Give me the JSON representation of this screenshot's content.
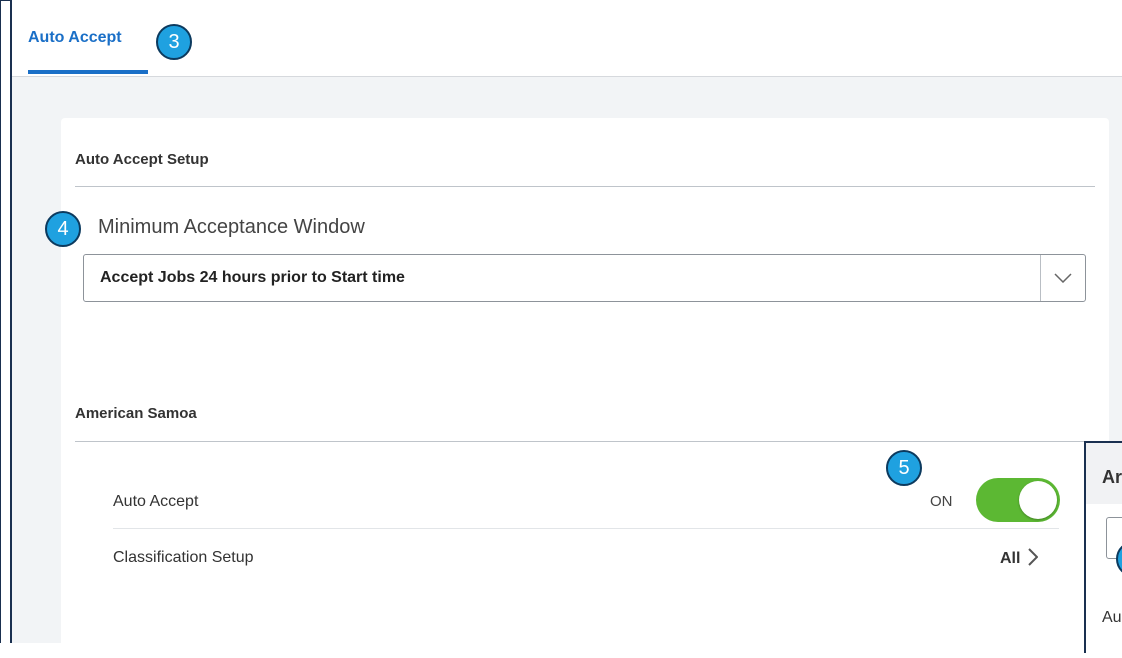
{
  "tabs": [
    {
      "label": "Auto Accept",
      "active": true
    }
  ],
  "badges": {
    "tab": "3",
    "window": "4",
    "toggle": "5"
  },
  "setup": {
    "title": "Auto Accept Setup",
    "min_window_label": "Minimum Acceptance Window",
    "min_window_value": "Accept Jobs 24 hours prior to Start time"
  },
  "region": {
    "title": "American Samoa",
    "rows": [
      {
        "label": "Auto Accept",
        "value": "ON"
      },
      {
        "label": "Classification Setup",
        "value": "All"
      }
    ]
  },
  "side_panel": {
    "title": "Ar",
    "text": "Au"
  },
  "colors": {
    "accent": "#1a6fc7",
    "badge": "#1fa1e0",
    "toggle_on": "#5cb833"
  }
}
